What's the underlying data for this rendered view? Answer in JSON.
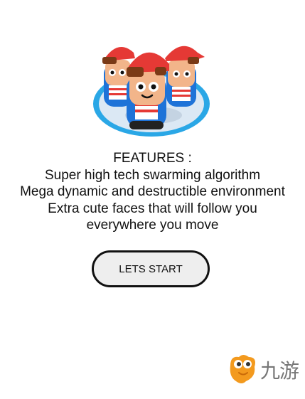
{
  "features": {
    "heading": "FEATURES :",
    "lines": [
      "Super high tech swarming algorithm",
      "Mega dynamic and destructible environment",
      "Extra cute faces that will follow you",
      "everywhere you move"
    ]
  },
  "start_button": {
    "label": "LETS START"
  },
  "watermark": {
    "text": "九游"
  },
  "colors": {
    "cap": "#e53935",
    "jacket": "#1e73d8",
    "ring": "#2aa7e6",
    "button_fill": "#eeeeee",
    "logo_orange": "#f39a1e"
  },
  "icons": {
    "hero": "character-group-illustration",
    "logo": "jiuyou-mascot-logo"
  }
}
